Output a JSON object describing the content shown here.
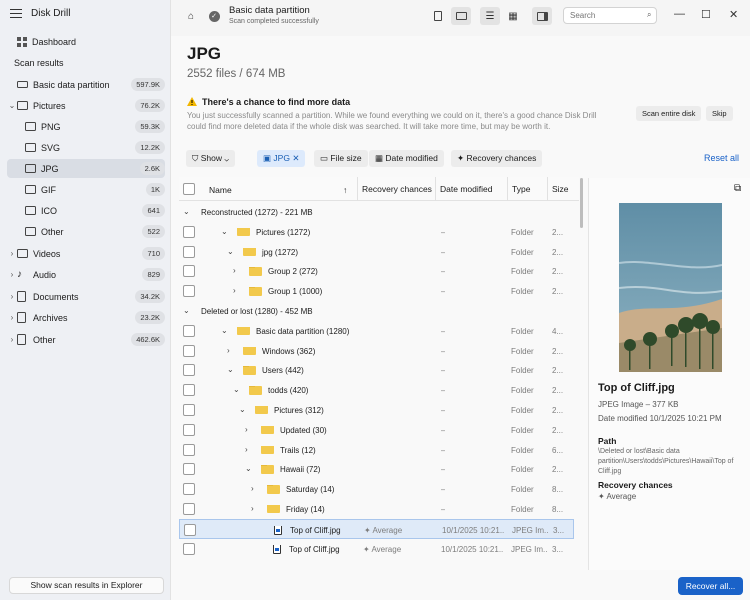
{
  "app": {
    "title": "Disk Drill"
  },
  "sidebar": {
    "dashboard": "Dashboard",
    "section": "Scan results",
    "items": [
      {
        "label": "Basic data partition",
        "badge": "597.9K"
      },
      {
        "label": "Pictures",
        "badge": "76.2K"
      },
      {
        "label": "PNG",
        "badge": "59.3K"
      },
      {
        "label": "SVG",
        "badge": "12.2K"
      },
      {
        "label": "JPG",
        "badge": "2.6K"
      },
      {
        "label": "GIF",
        "badge": "1K"
      },
      {
        "label": "ICO",
        "badge": "641"
      },
      {
        "label": "Other",
        "badge": "522"
      },
      {
        "label": "Videos",
        "badge": "710"
      },
      {
        "label": "Audio",
        "badge": "829"
      },
      {
        "label": "Documents",
        "badge": "34.2K"
      },
      {
        "label": "Archives",
        "badge": "23.2K"
      },
      {
        "label": "Other",
        "badge": "462.6K"
      }
    ],
    "footer_button": "Show scan results in Explorer"
  },
  "topbar": {
    "title": "Basic data partition",
    "subtitle": "Scan completed successfully",
    "search_placeholder": "Search"
  },
  "main": {
    "title": "JPG",
    "summary": "2552 files / 674 MB",
    "banner": {
      "title": "There's a chance to find more data",
      "text": "You just successfully scanned a partition. While we found everything we could on it, there's a good chance Disk Drill could find more deleted data if the whole disk was searched. It will take more time, but may be worth it.",
      "scan_button": "Scan entire disk",
      "skip_button": "Skip"
    },
    "filters": {
      "show": "Show",
      "jpg": "JPG",
      "file_size": "File size",
      "date_modified": "Date modified",
      "recovery_chances": "Recovery chances",
      "reset": "Reset all"
    },
    "columns": {
      "name": "Name",
      "recovery": "Recovery chances",
      "date": "Date modified",
      "type": "Type",
      "size": "Size"
    },
    "rows": [
      {
        "name": "Reconstructed (1272) - 221 MB",
        "kind": "group",
        "rec": "",
        "date": "",
        "type": "",
        "size": ""
      },
      {
        "name": "Pictures (1272)",
        "kind": "folder",
        "rec": "",
        "date": "–",
        "type": "Folder",
        "size": "2..."
      },
      {
        "name": "jpg (1272)",
        "kind": "folder",
        "rec": "",
        "date": "–",
        "type": "Folder",
        "size": "2..."
      },
      {
        "name": "Group 2 (272)",
        "kind": "folder",
        "rec": "",
        "date": "–",
        "type": "Folder",
        "size": "2..."
      },
      {
        "name": "Group 1 (1000)",
        "kind": "folder",
        "rec": "",
        "date": "–",
        "type": "Folder",
        "size": "2..."
      },
      {
        "name": "Deleted or lost (1280) - 452 MB",
        "kind": "group",
        "rec": "",
        "date": "",
        "type": "",
        "size": ""
      },
      {
        "name": "Basic data partition (1280)",
        "kind": "folder",
        "rec": "",
        "date": "–",
        "type": "Folder",
        "size": "4..."
      },
      {
        "name": "Windows (362)",
        "kind": "folder",
        "rec": "",
        "date": "–",
        "type": "Folder",
        "size": "2..."
      },
      {
        "name": "Users (442)",
        "kind": "folder",
        "rec": "",
        "date": "–",
        "type": "Folder",
        "size": "2..."
      },
      {
        "name": "todds (420)",
        "kind": "folder",
        "rec": "",
        "date": "–",
        "type": "Folder",
        "size": "2..."
      },
      {
        "name": "Pictures (312)",
        "kind": "folder",
        "rec": "",
        "date": "–",
        "type": "Folder",
        "size": "2..."
      },
      {
        "name": "Updated (30)",
        "kind": "folder",
        "rec": "",
        "date": "–",
        "type": "Folder",
        "size": "2..."
      },
      {
        "name": "Trails (12)",
        "kind": "folder",
        "rec": "",
        "date": "–",
        "type": "Folder",
        "size": "6..."
      },
      {
        "name": "Hawaii (72)",
        "kind": "folder",
        "rec": "",
        "date": "–",
        "type": "Folder",
        "size": "2..."
      },
      {
        "name": "Saturday (14)",
        "kind": "folder",
        "rec": "",
        "date": "–",
        "type": "Folder",
        "size": "8..."
      },
      {
        "name": "Friday (14)",
        "kind": "folder",
        "rec": "",
        "date": "–",
        "type": "Folder",
        "size": "8..."
      },
      {
        "name": "Top of Cliff.jpg",
        "kind": "file",
        "rec": "Average",
        "date": "10/1/2025 10:21...",
        "type": "JPEG Im...",
        "size": "3..."
      },
      {
        "name": "Top of Cliff.jpg",
        "kind": "file",
        "rec": "Average",
        "date": "10/1/2025 10:21...",
        "type": "JPEG Im...",
        "size": "3..."
      }
    ]
  },
  "preview": {
    "filename": "Top of Cliff.jpg",
    "kind": "JPEG Image – 377 KB",
    "modified": "Date modified 10/1/2025 10:21 PM",
    "path_label": "Path",
    "path": "\\Deleted or lost\\Basic data partition\\Users\\todds\\Pictures\\Hawaii\\Top of Cliff.jpg",
    "recovery_label": "Recovery chances",
    "recovery": "Average"
  },
  "recover_button": "Recover all..."
}
